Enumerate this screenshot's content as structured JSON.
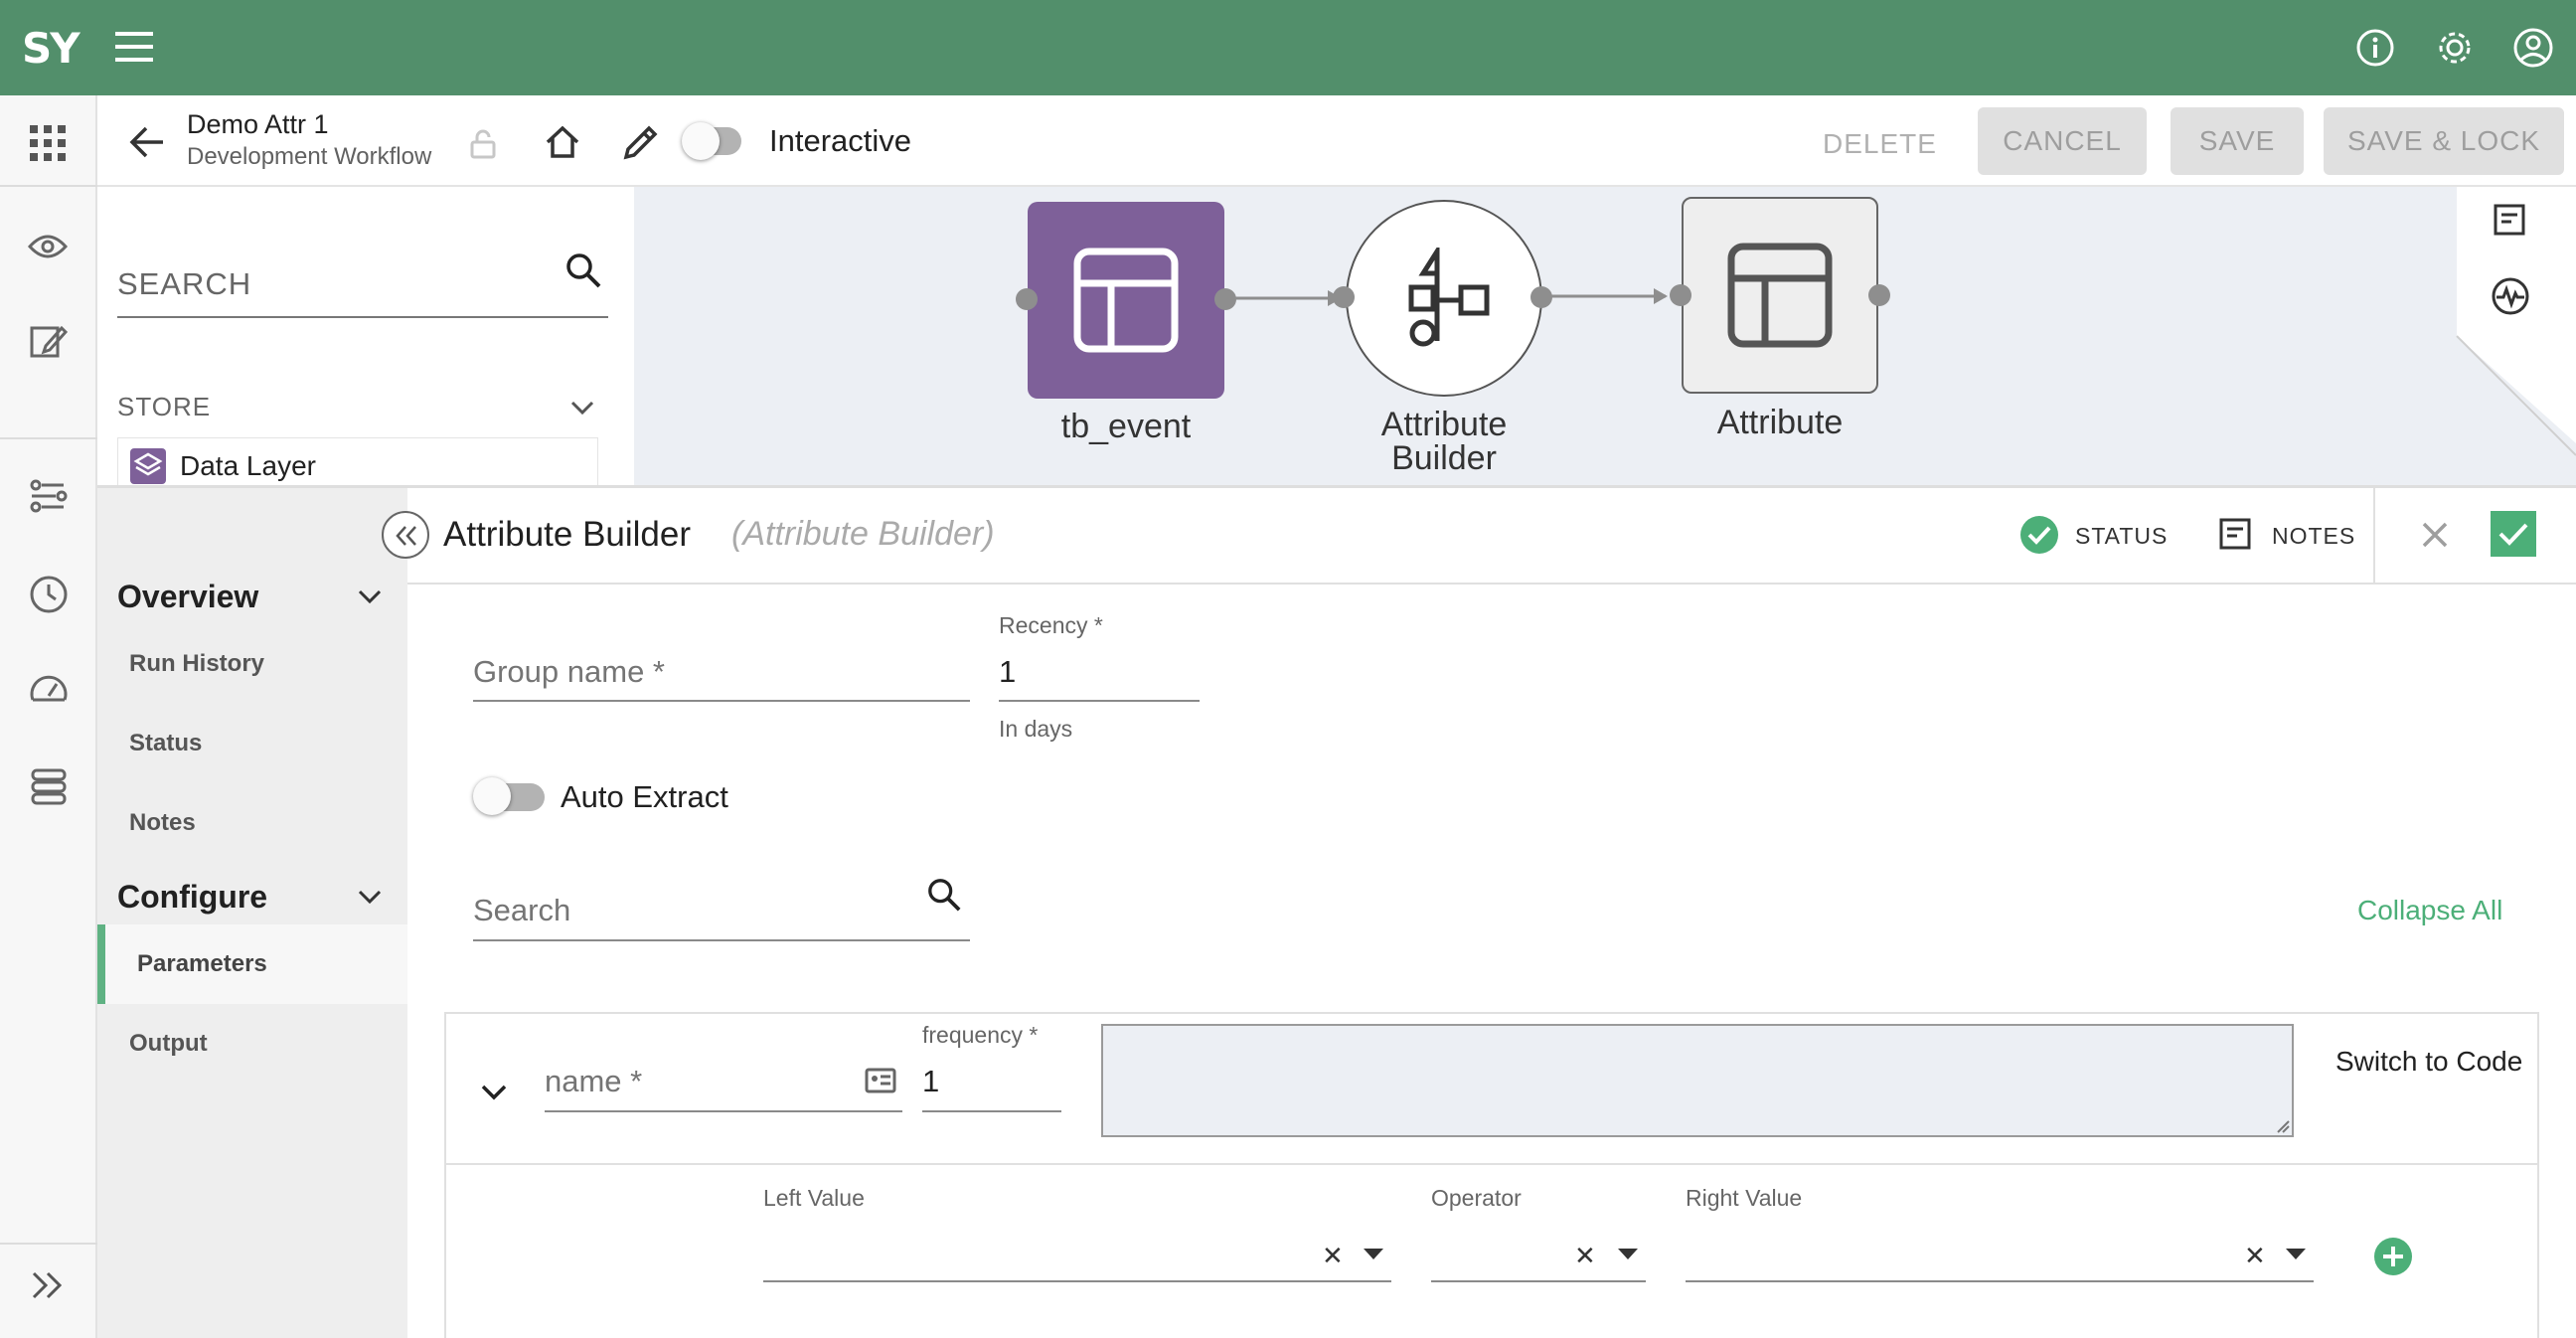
{
  "app": {
    "logo": "SY"
  },
  "header": {
    "title": "Demo Attr 1",
    "subtitle": "Development Workflow",
    "interactive_label": "Interactive",
    "delete_label": "DELETE",
    "cancel_label": "CANCEL",
    "save_label": "SAVE",
    "save_lock_label": "SAVE & LOCK"
  },
  "sidebar": {
    "search_placeholder": "SEARCH",
    "store_label": "STORE",
    "store_item": "Data Layer"
  },
  "workflow": {
    "nodes": [
      {
        "label": "tb_event",
        "color": "#7e6099"
      },
      {
        "label": "Attribute Builder"
      },
      {
        "label": "Attribute"
      }
    ]
  },
  "panel": {
    "title": "Attribute Builder",
    "subtitle": "(Attribute Builder)",
    "status_label": "STATUS",
    "notes_label": "NOTES"
  },
  "nav": {
    "overview": "Overview",
    "overview_items": [
      "Run History",
      "Status",
      "Notes"
    ],
    "configure": "Configure",
    "configure_items": [
      "Parameters",
      "Output"
    ]
  },
  "form": {
    "group_name_placeholder": "Group name *",
    "recency_label": "Recency *",
    "recency_value": "1",
    "recency_hint": "In days",
    "auto_extract_label": "Auto Extract",
    "search_placeholder": "Search",
    "collapse_all_label": "Collapse All",
    "attribute": {
      "name_placeholder": "name *",
      "frequency_label": "frequency *",
      "frequency_value": "1",
      "switch_to_code": "Switch to Code",
      "left_value_label": "Left Value",
      "operator_label": "Operator",
      "right_value_label": "Right Value"
    }
  },
  "colors": {
    "brand_green": "#528f6b",
    "accent_green": "#4caf78",
    "node_purple": "#7e6099"
  }
}
